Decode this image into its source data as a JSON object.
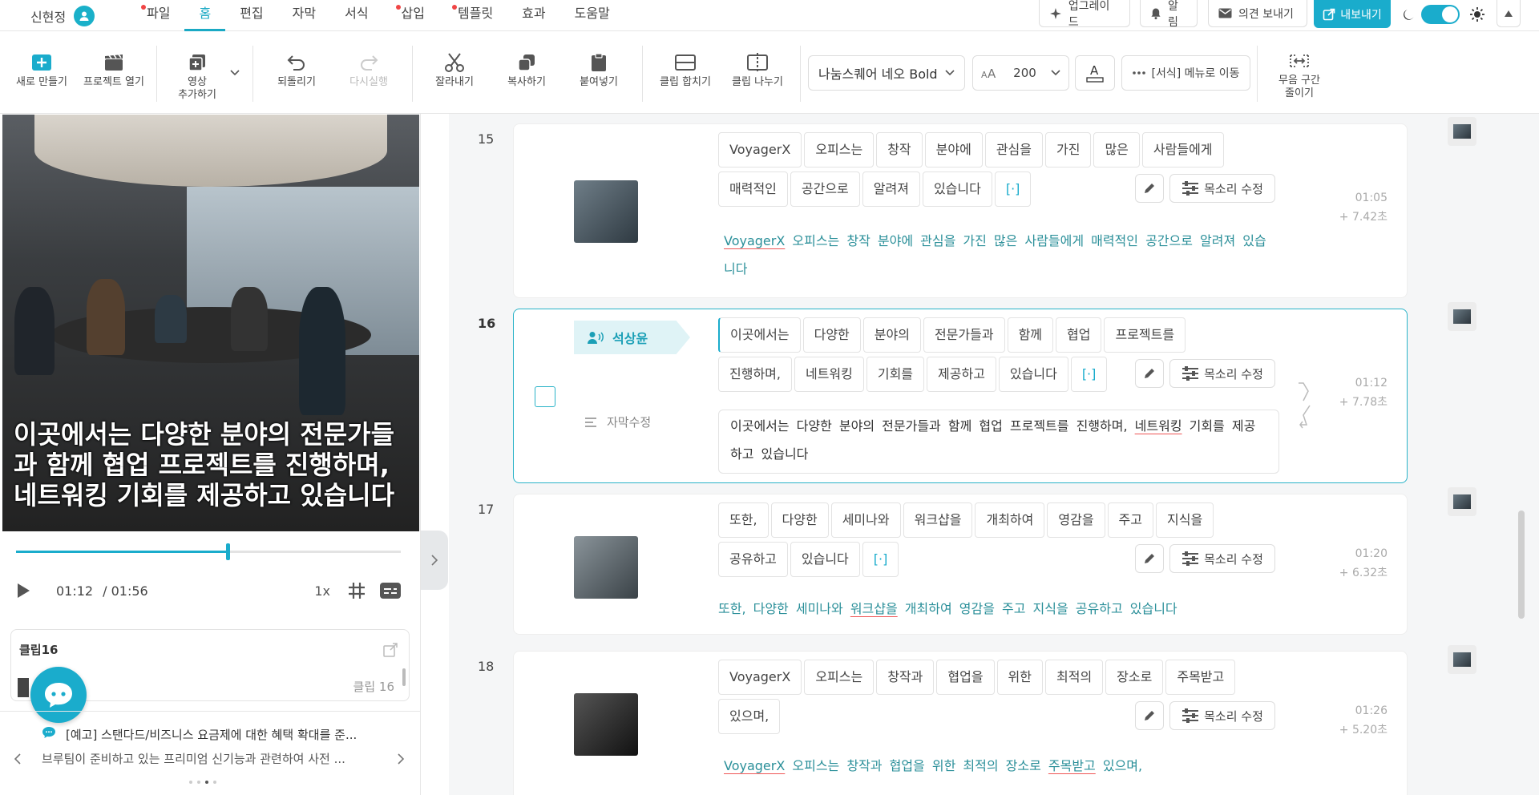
{
  "header": {
    "user_name": "신현정",
    "menus": [
      {
        "label": "파일",
        "dot": true
      },
      {
        "label": "홈",
        "active": true
      },
      {
        "label": "편집"
      },
      {
        "label": "자막"
      },
      {
        "label": "서식"
      },
      {
        "label": "삽입",
        "dot": true
      },
      {
        "label": "템플릿",
        "dot": true
      },
      {
        "label": "효과"
      },
      {
        "label": "도움말"
      }
    ],
    "upgrade": "업그레이드",
    "alarm": "알림",
    "feedback": "의견 보내기",
    "export": "내보내기",
    "accent": "#1aaccc"
  },
  "ribbon": {
    "new": "새로 만들기",
    "open": "프로젝트 열기",
    "add_video_1": "영상",
    "add_video_2": "추가하기",
    "undo": "되돌리기",
    "redo": "다시실행",
    "cut": "잘라내기",
    "copy": "복사하기",
    "paste": "붙여넣기",
    "merge": "클립 합치기",
    "split": "클립 나누기",
    "font": "나눔스퀘어 네오 Bold",
    "font_size": "200",
    "format_menu": "[서식] 메뉴로 이동",
    "silence_1": "무음 구간",
    "silence_2": "줄이기"
  },
  "player": {
    "subtitle": "이곳에서는 다양한 분야의 전문가들과 함께 협업 프로젝트를 진행하며, 네트워킹 기회를 제공하고 있습니다",
    "current_time": "01:12",
    "total_time": "/ 01:56",
    "progress": 0.55,
    "speed": "1x",
    "clip_title": "클립16",
    "clip_label": "클립 16"
  },
  "notice": {
    "title": "[예고] 스탠다드/비즈니스 요금제에 대한 혜택 확대를 준...",
    "body": "브루팀이 준비하고 있는 프리미엄 신기능과 관련하여 사전 ...",
    "page_count": 4,
    "page_active": 2
  },
  "clips": [
    {
      "num": "15",
      "words": [
        "VoyagerX",
        "오피스는",
        "창작",
        "분야에",
        "관심을",
        "가진",
        "많은",
        "사람들에게",
        "매력적인",
        "공간으로",
        "알려져",
        "있습니다",
        "[·]"
      ],
      "line2_start": 8,
      "sentence": [
        "VoyagerX",
        " 오피스는 창작 분야에 관심을 가진 많은 사람들에게 매력적인 공간으로 알려져 있습니다"
      ],
      "time": "01:05",
      "duration": "+ 7.42초",
      "voice": "목소리 수정"
    },
    {
      "num": "16",
      "speaker": "석상윤",
      "edit_label": "자막수정",
      "words": [
        "이곳에서는",
        "다양한",
        "분야의",
        "전문가들과",
        "함께",
        "협업",
        "프로젝트를",
        "진행하며,",
        "네트워킹",
        "기회를",
        "제공하고",
        "있습니다",
        "[·]"
      ],
      "line2_start": 7,
      "sentence": [
        "이곳에서는 다양한 분야의 전문가들과 함께 협업 프로젝트를 진행하며, ",
        "네트워킹",
        " 기회를 제공하고 있습니다"
      ],
      "time": "01:12",
      "duration": "+ 7.78초",
      "voice": "목소리 수정"
    },
    {
      "num": "17",
      "words": [
        "또한,",
        "다양한",
        "세미나와",
        "워크샵을",
        "개최하여",
        "영감을",
        "주고",
        "지식을",
        "공유하고",
        "있습니다",
        "[·]"
      ],
      "line2_start": 8,
      "sentence": [
        "또한, 다양한 세미나와 ",
        "워크샵을",
        " 개최하여 영감을 주고 지식을 공유하고 있습니다"
      ],
      "time": "01:20",
      "duration": "+ 6.32초",
      "voice": "목소리 수정"
    },
    {
      "num": "18",
      "words": [
        "VoyagerX",
        "오피스는",
        "창작과",
        "협업을",
        "위한",
        "최적의",
        "장소로",
        "주목받고",
        "있으며,"
      ],
      "line2_start": 8,
      "sentence": [
        "VoyagerX",
        " 오피스는 창작과 협업을 위한 최적의 장소로 ",
        "주목받고",
        " 있으며,"
      ],
      "time": "01:26",
      "duration": "+ 5.20초",
      "voice": "목소리 수정"
    }
  ]
}
